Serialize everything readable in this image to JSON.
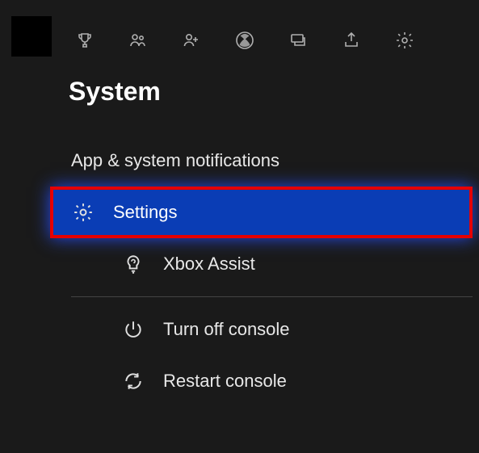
{
  "header": {
    "title": "System"
  },
  "menu": {
    "notifications": {
      "label": "App & system notifications"
    },
    "settings": {
      "label": "Settings"
    },
    "assist": {
      "label": "Xbox Assist"
    },
    "power_off": {
      "label": "Turn off console"
    },
    "restart": {
      "label": "Restart console"
    }
  }
}
